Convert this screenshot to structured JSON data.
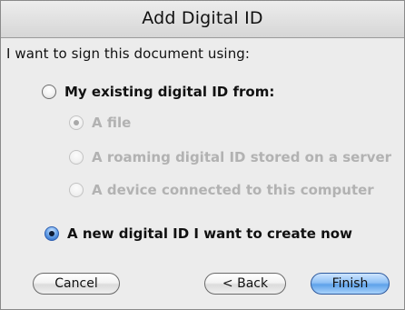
{
  "dialog": {
    "title": "Add Digital ID",
    "prompt": "I want to sign this document using:"
  },
  "options": {
    "existing": {
      "label": "My existing digital ID from:",
      "selected": false
    },
    "file": {
      "label": "A file",
      "selected": true,
      "disabled": true
    },
    "roaming": {
      "label": "A roaming digital ID stored on a server",
      "selected": false,
      "disabled": true
    },
    "device": {
      "label": "A device connected to this computer",
      "selected": false,
      "disabled": true
    },
    "new_id": {
      "label": "A new digital ID I want to create now",
      "selected": true
    }
  },
  "buttons": {
    "cancel": "Cancel",
    "back": "< Back",
    "finish": "Finish"
  },
  "colors": {
    "accent": "#5ea2ea",
    "background": "#ececec",
    "disabled_text": "#b2b2b2"
  }
}
